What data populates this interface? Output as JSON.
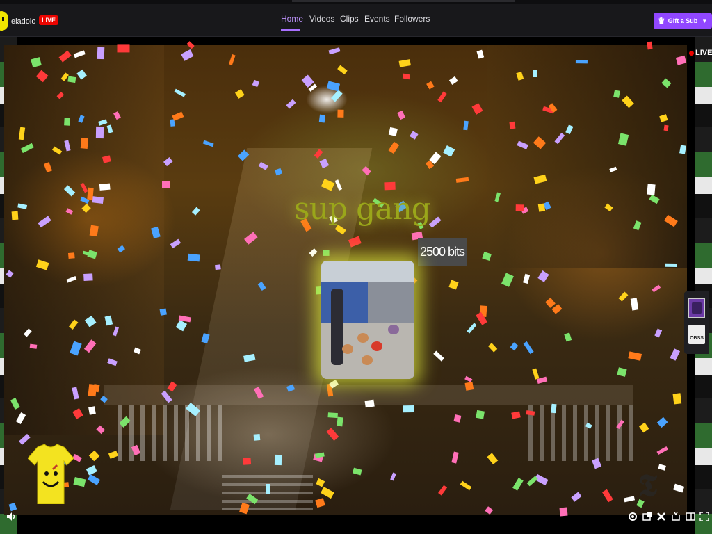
{
  "header": {
    "channel_name": "eladolo",
    "live_badge": "LIVE",
    "nav": [
      {
        "label": "Home",
        "active": true
      },
      {
        "label": "Videos",
        "active": false
      },
      {
        "label": "Clips",
        "active": false
      },
      {
        "label": "Events",
        "active": false
      },
      {
        "label": "Followers",
        "active": false
      }
    ],
    "gift_button": "Gift a Sub",
    "gift_icon": "crown-icon"
  },
  "player": {
    "live_indicator": "LIVE",
    "alert": {
      "message": "sup gang",
      "bits": "2500 bits"
    },
    "extensions": {
      "ext2_label": "OBSS"
    },
    "controls": {
      "volume_icon": "volume-icon",
      "right_icons": [
        "settings-icon",
        "picture-in-picture-icon",
        "close-icon",
        "theatre-mode-icon",
        "sidebar-icon",
        "fullscreen-icon"
      ]
    }
  },
  "colors": {
    "accent": "#9147ff",
    "accent_text": "#bf94ff",
    "live_red": "#eb0400",
    "alert_text": "#9aa61a",
    "topbar_bg": "#18181b"
  }
}
